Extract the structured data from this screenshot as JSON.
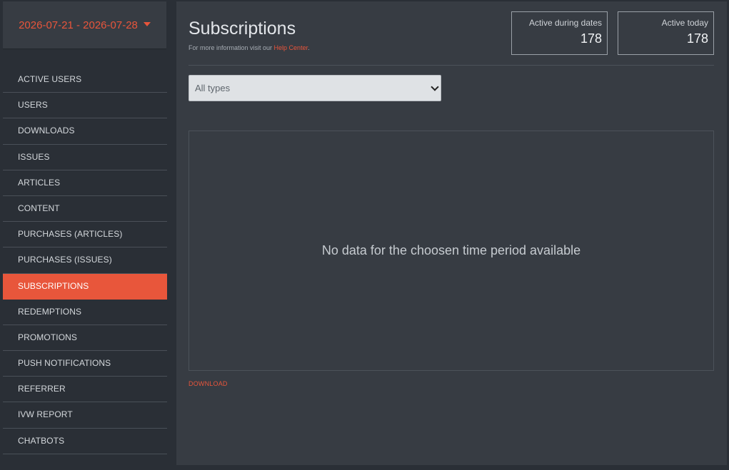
{
  "sidebar": {
    "date_range": "2026-07-21 - 2026-07-28",
    "items": [
      {
        "label": "ACTIVE USERS"
      },
      {
        "label": "USERS"
      },
      {
        "label": "DOWNLOADS"
      },
      {
        "label": "ISSUES"
      },
      {
        "label": "ARTICLES"
      },
      {
        "label": "CONTENT"
      },
      {
        "label": "PURCHASES (ARTICLES)"
      },
      {
        "label": "PURCHASES (ISSUES)"
      },
      {
        "label": "SUBSCRIPTIONS"
      },
      {
        "label": "REDEMPTIONS"
      },
      {
        "label": "PROMOTIONS"
      },
      {
        "label": "PUSH NOTIFICATIONS"
      },
      {
        "label": "REFERRER"
      },
      {
        "label": "IVW REPORT"
      },
      {
        "label": "CHATBOTS"
      }
    ],
    "active_item": "SUBSCRIPTIONS"
  },
  "header": {
    "title": "Subscriptions",
    "info_prefix": "For more information visit our ",
    "info_link": "Help Center",
    "info_suffix": "."
  },
  "stats": {
    "active_during_dates": {
      "label": "Active during dates",
      "value": "178"
    },
    "active_today": {
      "label": "Active today",
      "value": "178"
    }
  },
  "filter": {
    "selected": "All types"
  },
  "chart": {
    "empty_message": "No data for the choosen time period available"
  },
  "download_label": "DOWNLOAD",
  "colors": {
    "accent": "#e8563b",
    "sidebar_bg": "#2a2f36",
    "panel_bg": "#373c43"
  }
}
